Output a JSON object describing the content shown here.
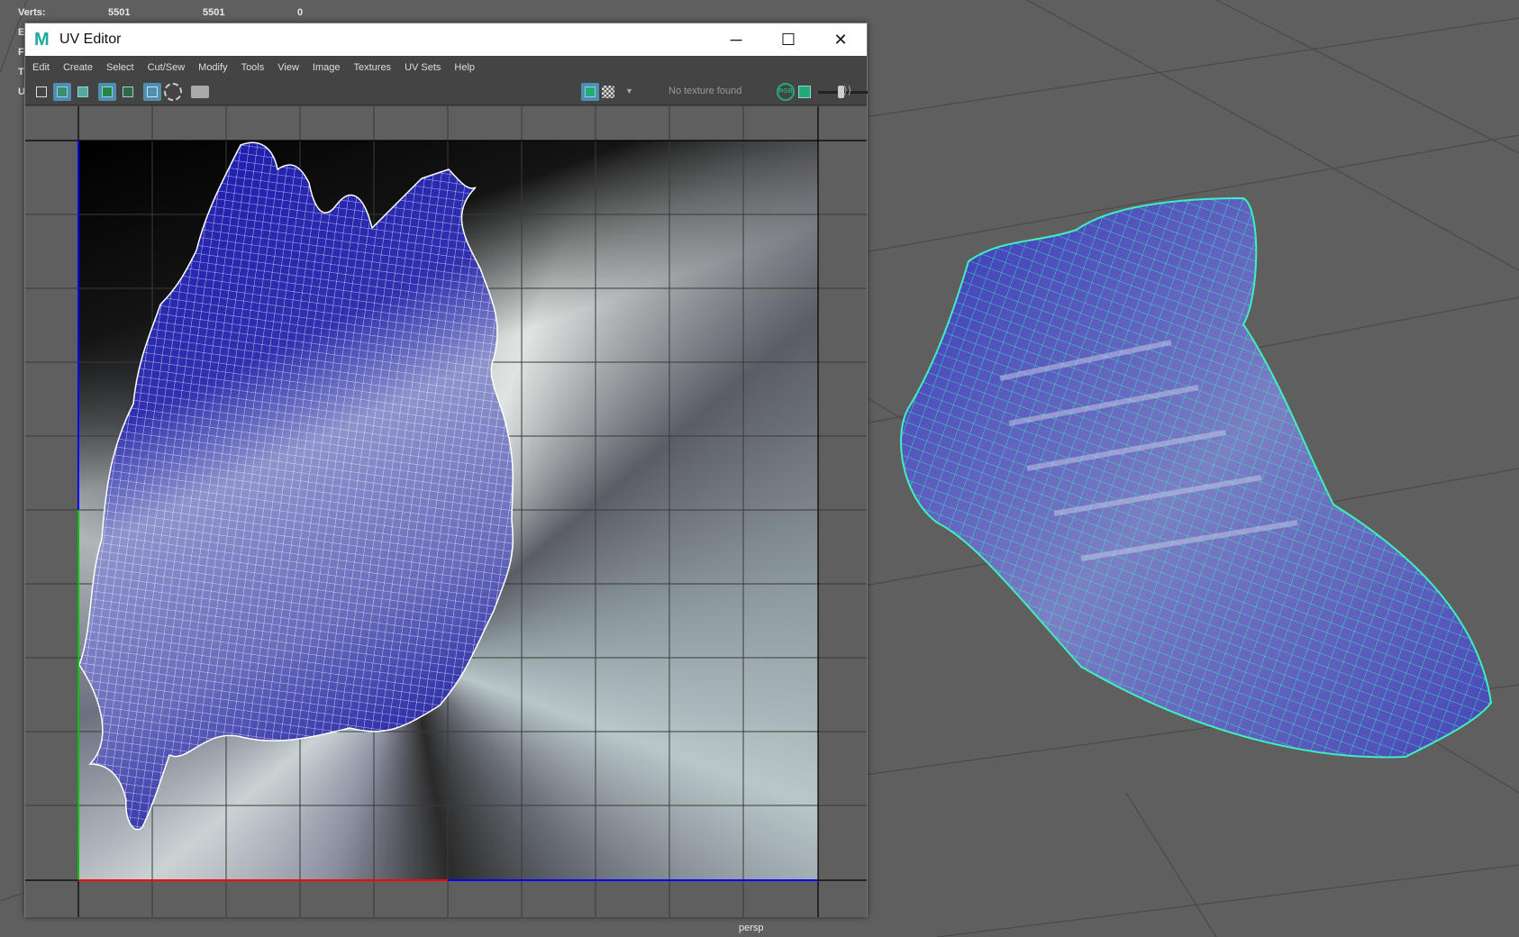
{
  "hud": {
    "rows": [
      {
        "label": "Verts:",
        "v1": "5501",
        "v2": "5501",
        "v3": "0"
      },
      {
        "label": "E"
      },
      {
        "label": "F"
      },
      {
        "label": "T"
      },
      {
        "label": "U"
      }
    ]
  },
  "window": {
    "title": "UV Editor",
    "logo": "M",
    "minimize": "─",
    "maximize": "☐",
    "close": "✕"
  },
  "menu": [
    "Edit",
    "Create",
    "Select",
    "Cut/Sew",
    "Modify",
    "Tools",
    "View",
    "Image",
    "Textures",
    "UV Sets",
    "Help"
  ],
  "toolbar": {
    "texture_status": "No texture found",
    "rgb_label": "RGB"
  },
  "viewport": {
    "camera": "persp"
  },
  "colors": {
    "uv_mesh": "#2a2ab0",
    "wire": "#3cf0c0",
    "u_axis": "#ff0000",
    "v_axis": "#0000ff"
  }
}
